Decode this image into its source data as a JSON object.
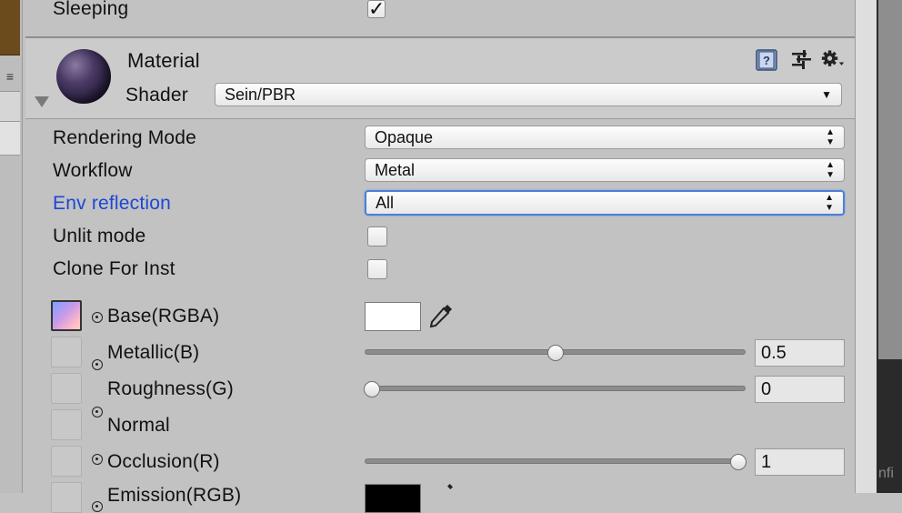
{
  "rigidbody": {
    "sleeping_label": "Sleeping",
    "sleeping_checked": true
  },
  "material": {
    "title": "Material",
    "shader_label": "Shader",
    "shader_value": "Sein/PBR",
    "icons": [
      "book-icon",
      "sliders-icon",
      "gear-icon"
    ]
  },
  "properties": {
    "rendering_mode": {
      "label": "Rendering Mode",
      "value": "Opaque"
    },
    "workflow": {
      "label": "Workflow",
      "value": "Metal"
    },
    "env_reflection": {
      "label": "Env reflection",
      "value": "All",
      "label_color": "#1c47d6"
    },
    "unlit_mode": {
      "label": "Unlit mode",
      "checked": false
    },
    "clone_for_inst": {
      "label": "Clone For Inst",
      "checked": false
    }
  },
  "textures": {
    "base": {
      "label": "Base(RGBA)",
      "color": "#ffffff"
    },
    "metallic": {
      "label": "Metallic(B)",
      "value": "0.5",
      "fraction": 0.5
    },
    "roughness": {
      "label": "Roughness(G)",
      "value": "0",
      "fraction": 0.0
    },
    "normal": {
      "label": "Normal"
    },
    "occlusion": {
      "label": "Occlusion(R)",
      "value": "1",
      "fraction": 1.0
    },
    "emission": {
      "label": "Emission(RGB)",
      "color": "#000000"
    }
  },
  "right_panel_fragment": "nfi"
}
